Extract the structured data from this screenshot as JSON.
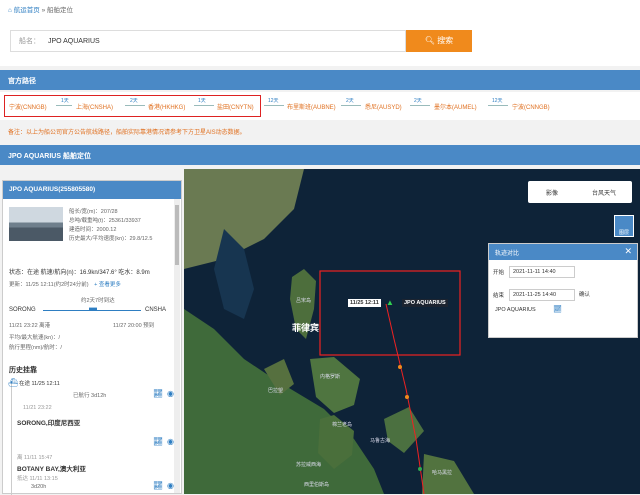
{
  "breadcrumb": {
    "home": "航运首页",
    "sep": "»",
    "current": "船舶定位"
  },
  "search": {
    "label": "船名：",
    "value": "JPO AQUARIUS",
    "button": "搜索"
  },
  "official_route": {
    "title": "官方路径",
    "ports": [
      "宁波(CNNGB)",
      "上海(CNSHA)",
      "香港(HKHKG)",
      "盐田(CNYTN)",
      "布里斯班(AUBNE)",
      "悉尼(AUSYD)",
      "墨尔本(AUMEL)",
      "宁波(CNNGB)"
    ],
    "legs": [
      "1天",
      "2天",
      "1天",
      "12天",
      "2天",
      "2天",
      "12天"
    ]
  },
  "note": "备注：以上为船公司官方公告航线路径，船舶实际靠港情况请参考下方卫星AIS动态数据。",
  "tracking_title": "JPO AQUARIUS 船舶定位",
  "ship": {
    "header": "JPO AQUARIUS(255805580)",
    "info": [
      "船长/宽(m)：207/28",
      "总吨/载重吨(t)：25361/33937",
      "建造时间：2000.12",
      "历史最大/平均速度(kn)：29.8/12.5"
    ],
    "status": "状态：在途  航速/航向(n)：16.9kn/347.6°  吃水：8.9m",
    "update": "更新：11/25 12:11(约2时24分前)",
    "more": "+ 查看更多",
    "voyage_note": "约2天7时到达",
    "origin": "SORONG",
    "destination": "CNSHA",
    "departure": "11/21 23:22 离港",
    "eta": "11/27 20:00 预到",
    "speed_line": "平均/最大航速(kn)：/",
    "distance_line": "航行里程(nm)/航时：/",
    "history_title": "历史挂靠",
    "history": [
      {
        "time": "在途 11/25 12:11",
        "sub": "已航行 3d12h"
      },
      {
        "time": "11/21 23:22",
        "port": "SORONG,印度尼西亚"
      },
      {
        "time": "离 11/11 15:47",
        "port": "BOTANY BAY,澳大利亚",
        "sub": "抵达 11/11 13:15",
        "dur": "3d20h"
      }
    ]
  },
  "map": {
    "types": [
      "影像",
      "台风天气"
    ],
    "layer": "图层",
    "ship_time": "11/25 12:11",
    "ship_name": "JPO AQUARIUS",
    "country": "菲律宾",
    "places": [
      "吕宋岛",
      "巴拉望",
      "内格罗斯",
      "棉兰老岛",
      "马鲁古海",
      "苏拉威西海",
      "西里伯斯岛",
      "哈马黑拉"
    ]
  },
  "track": {
    "title": "轨迹对比",
    "start_label": "开始",
    "start": "2021-11-11 14:40",
    "end_label": "结束",
    "end": "2021-11-25 14:40",
    "confirm": "确认",
    "ship": "JPO AQUARIUS"
  }
}
